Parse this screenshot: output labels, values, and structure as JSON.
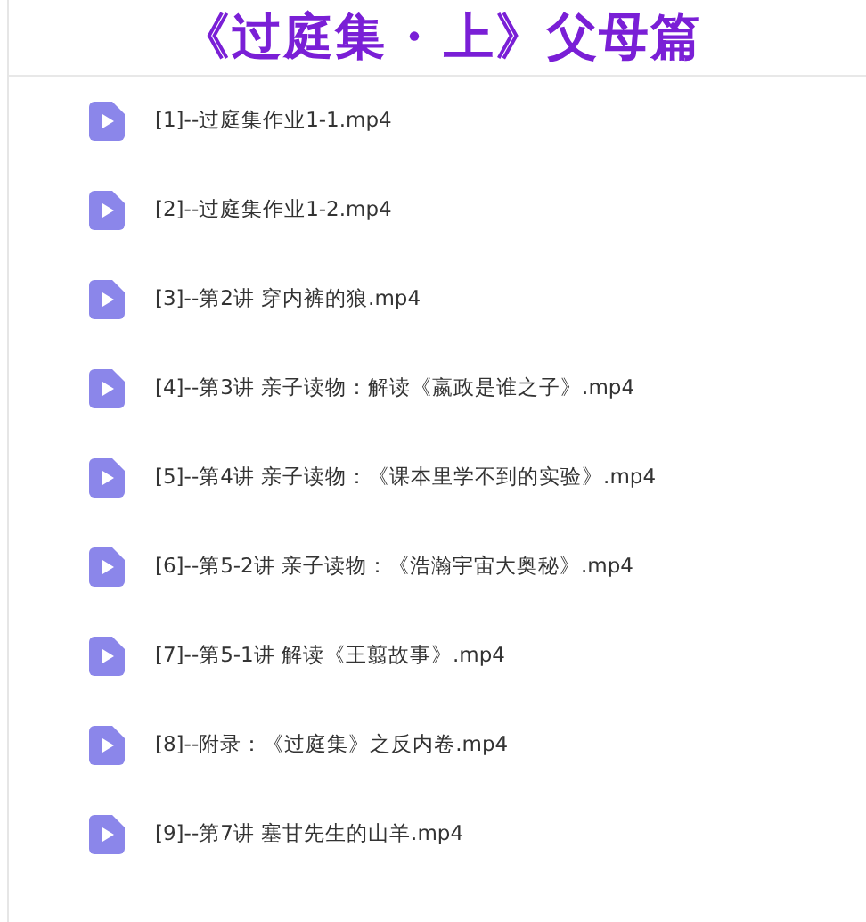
{
  "title": "《过庭集 · 上》父母篇",
  "files": [
    {
      "name": "[1]--过庭集作业1-1.mp4"
    },
    {
      "name": "[2]--过庭集作业1-2.mp4"
    },
    {
      "name": "[3]--第2讲 穿内裤的狼.mp4"
    },
    {
      "name": "[4]--第3讲 亲子读物：解读《嬴政是谁之子》.mp4"
    },
    {
      "name": "[5]--第4讲 亲子读物：《课本里学不到的实验》.mp4"
    },
    {
      "name": "[6]--第5-2讲 亲子读物：《浩瀚宇宙大奥秘》.mp4"
    },
    {
      "name": "[7]--第5-1讲 解读《王翦故事》.mp4"
    },
    {
      "name": "[8]--附录：《过庭集》之反内卷.mp4"
    },
    {
      "name": "[9]--第7讲 塞甘先生的山羊.mp4"
    }
  ]
}
